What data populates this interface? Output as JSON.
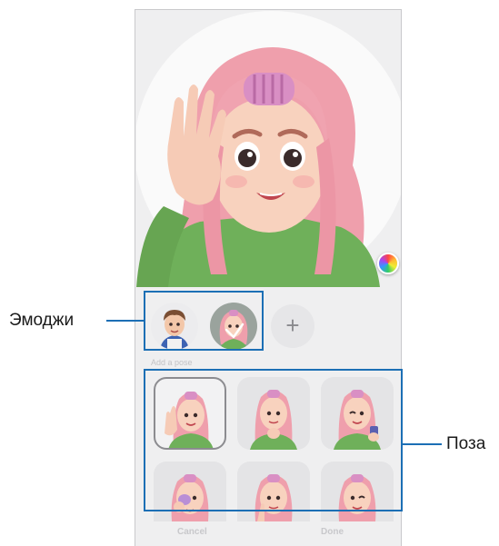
{
  "emoji_list": {
    "items": [
      {
        "name": "avatar-boy"
      },
      {
        "name": "avatar-girl"
      }
    ],
    "add_label": "+"
  },
  "pose_section": {
    "title": "Add a pose",
    "poses": [
      {
        "name": "pose-wave"
      },
      {
        "name": "pose-thinking"
      },
      {
        "name": "pose-wink-phone"
      },
      {
        "name": "pose-makeup"
      },
      {
        "name": "pose-finger-cheek"
      },
      {
        "name": "pose-wink"
      }
    ]
  },
  "bottom_bar": {
    "cancel_label": "Cancel",
    "done_label": "Done"
  },
  "callouts": {
    "emoji_label": "Эмоджи",
    "pose_label": "Поза"
  },
  "colors": {
    "callout": "#1c6fb5",
    "hair": "#f0a7b3",
    "sweater": "#6fb05a",
    "background": "#efeff0"
  }
}
